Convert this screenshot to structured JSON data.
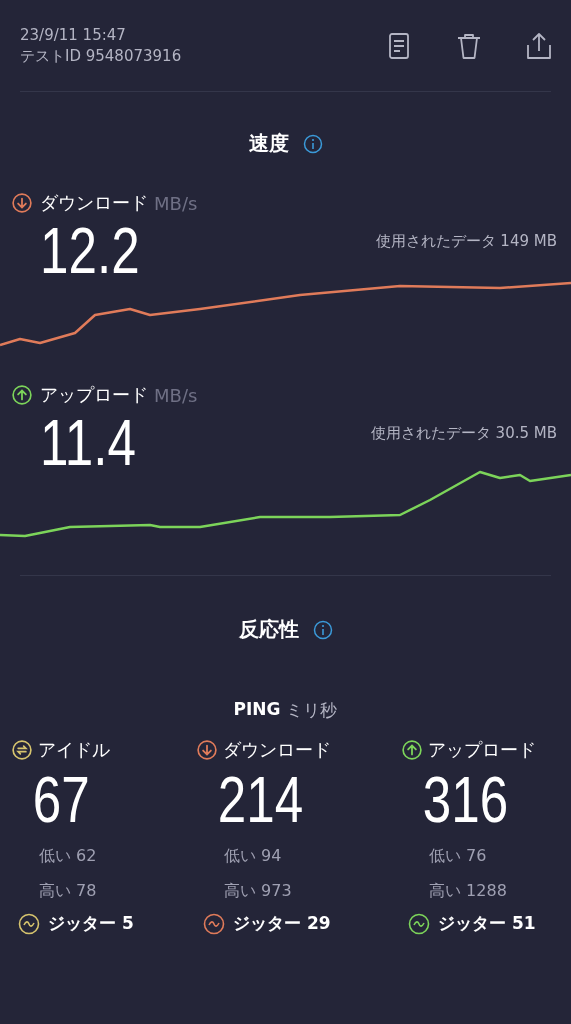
{
  "header": {
    "date": "23/9/11 15:47",
    "test_id": "テストID 9548073916"
  },
  "speed": {
    "title": "速度",
    "metrics": [
      {
        "kind": "download",
        "label": "ダウンロード",
        "unit": "MB/s",
        "value": "12.2",
        "data_used": "使用されたデータ 149 MB"
      },
      {
        "kind": "upload",
        "label": "アップロード",
        "unit": "MB/s",
        "value": "11.4",
        "data_used": "使用されたデータ 30.5 MB"
      }
    ]
  },
  "responsiveness": {
    "title": "反応性",
    "ping_label": "PING",
    "ping_unit": "ミリ秒",
    "columns": [
      {
        "kind": "idle",
        "color": "#d6c46e",
        "label": "アイドル",
        "value": "67",
        "low": "低い 62",
        "high": "高い 78",
        "jitter": "ジッター 5"
      },
      {
        "kind": "download",
        "color": "#e07b5a",
        "label": "ダウンロード",
        "value": "214",
        "low": "低い 94",
        "high": "高い 973",
        "jitter": "ジッター 29"
      },
      {
        "kind": "upload",
        "color": "#7cd45a",
        "label": "アップロード",
        "value": "316",
        "low": "低い 76",
        "high": "高い 1288",
        "jitter": "ジッター 51"
      }
    ]
  }
}
